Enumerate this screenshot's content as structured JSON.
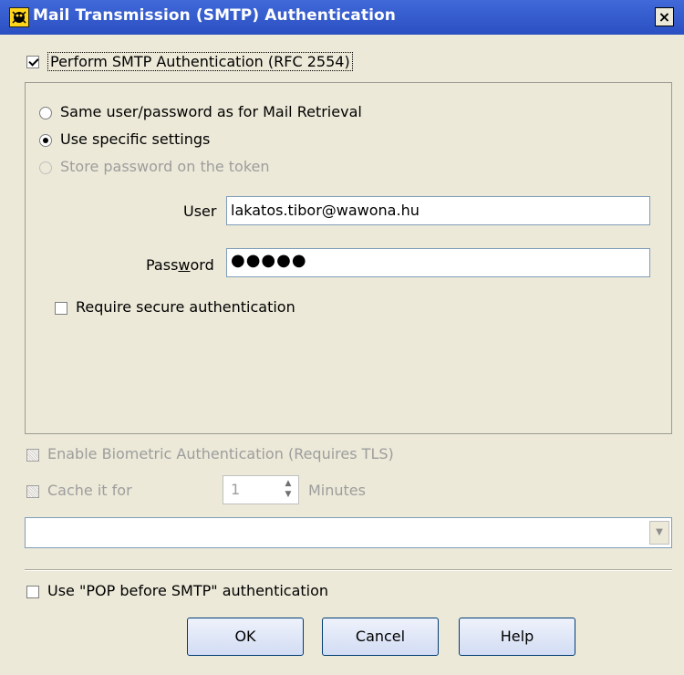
{
  "window": {
    "title": "Mail Transmission (SMTP) Authentication",
    "close_label": "×",
    "icon": "app-icon"
  },
  "perform_auth": {
    "label": "Perform SMTP Authentication (RFC 2554)",
    "checked": true
  },
  "options": {
    "same_user": {
      "label": "Same user/password as for Mail Retrieval",
      "selected": false
    },
    "specific": {
      "label": "Use specific settings",
      "selected": true
    },
    "store_token": {
      "label": "Store password on the token",
      "selected": false,
      "enabled": false
    }
  },
  "user": {
    "label": "User",
    "value": "lakatos.tibor@wawona.hu"
  },
  "password": {
    "label": "Password",
    "value": "●●●●●"
  },
  "require_secure": {
    "label": "Require secure authentication",
    "checked": false
  },
  "biometric": {
    "label": "Enable Biometric Authentication (Requires TLS)",
    "enabled": false
  },
  "cache": {
    "label": "Cache it for",
    "value": "1",
    "unit_label": "Minutes",
    "enabled": false
  },
  "dropdown": {
    "selected": ""
  },
  "pop_before_smtp": {
    "label": "Use \"POP before SMTP\" authentication",
    "checked": false
  },
  "buttons": {
    "ok": "OK",
    "cancel": "Cancel",
    "help": "Help"
  }
}
